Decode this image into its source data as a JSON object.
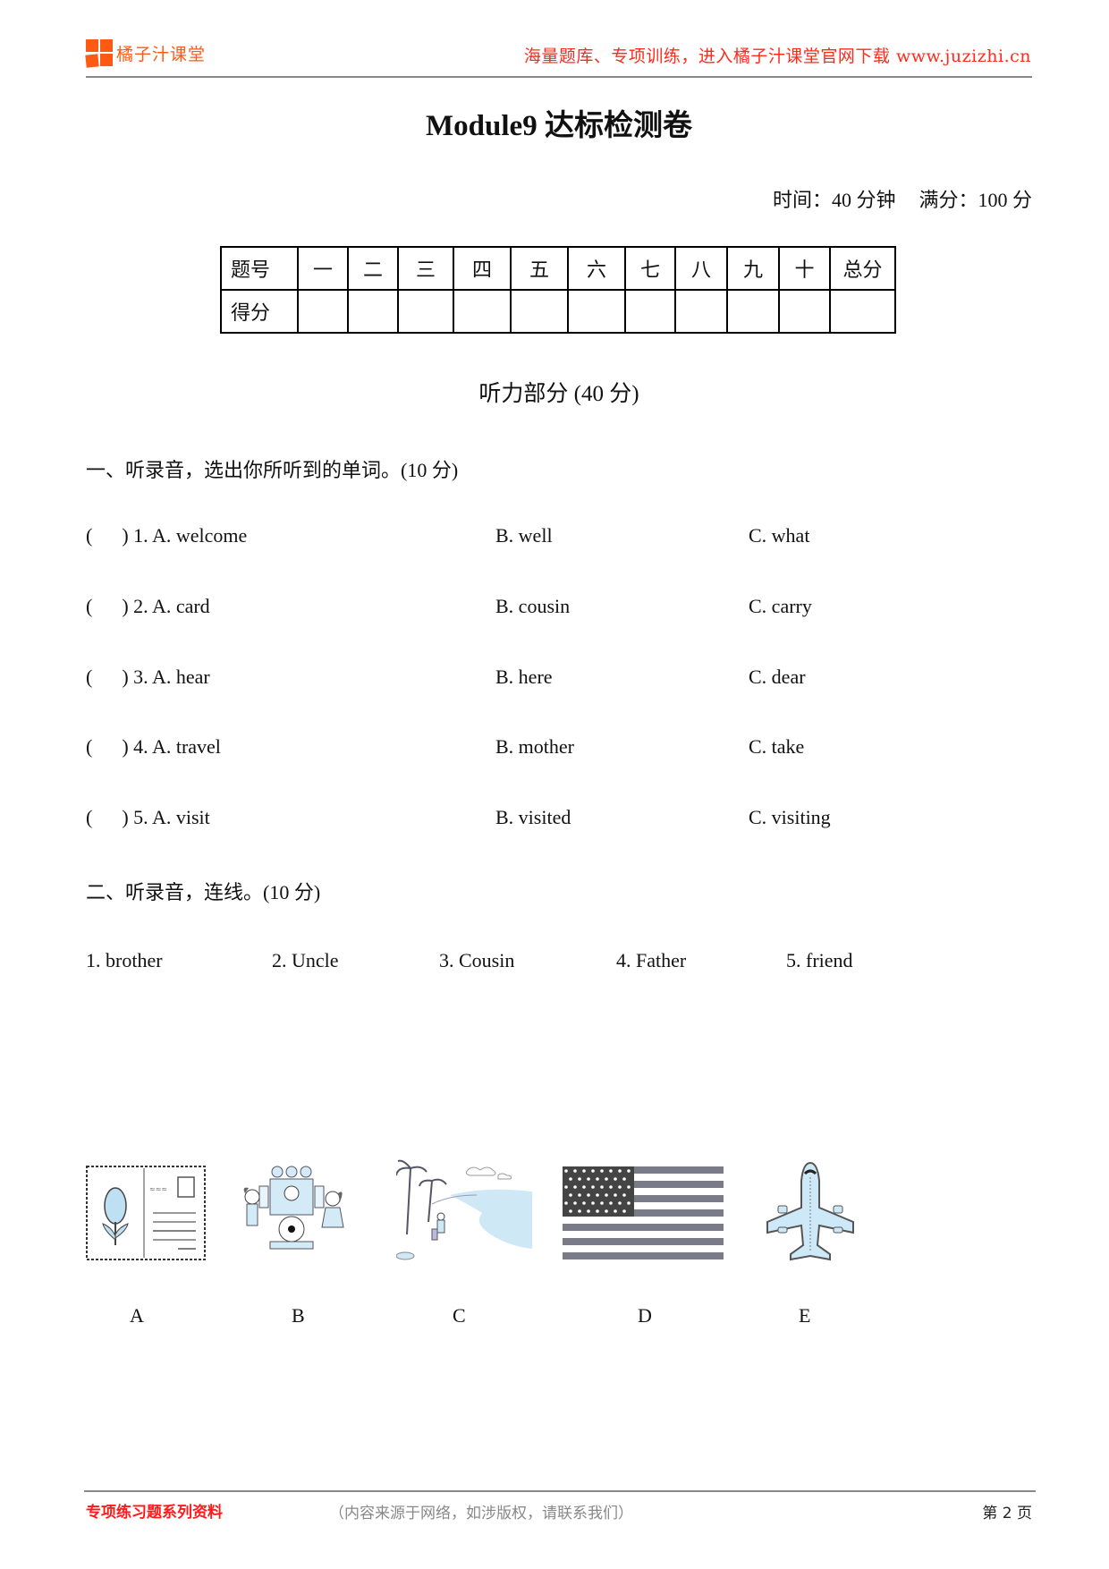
{
  "header": {
    "brand": "橘子汁课堂",
    "slogan": "海量题库、专项训练，进入橘子汁课堂官网下载 www.juzizhi.cn",
    "brand_color": "#ff5a14",
    "slogan_color": "#ff2a1a"
  },
  "title": "Module9 达标检测卷",
  "meta": {
    "time": "时间：40 分钟",
    "score": "满分：100 分"
  },
  "score_table": {
    "row1_label": "题号",
    "row2_label": "得分",
    "columns": [
      "一",
      "二",
      "三",
      "四",
      "五",
      "六",
      "七",
      "八",
      "九",
      "十",
      "总分"
    ]
  },
  "part_title": "听力部分 (40 分)",
  "section1": {
    "heading": "一、听录音，选出你所听到的单词。(10 分)",
    "questions": [
      {
        "a": "(      ) 1. A. welcome",
        "b": "B. well",
        "c": "C. what"
      },
      {
        "a": "(      ) 2. A. card",
        "b": "B. cousin",
        "c": "C. carry"
      },
      {
        "a": "(      ) 3. A. hear",
        "b": "B. here",
        "c": "C. dear"
      },
      {
        "a": "(      ) 4. A. travel",
        "b": "B. mother",
        "c": "C. take"
      },
      {
        "a": "(      ) 5. A. visit",
        "b": "B. visited",
        "c": "C. visiting"
      }
    ]
  },
  "section2": {
    "heading": "二、听录音，连线。(10 分)",
    "words": [
      "1. brother",
      "2. Uncle",
      "3. Cousin",
      "4. Father",
      "5. friend"
    ],
    "pictures": [
      {
        "label": "A",
        "icon": "postcard-icon"
      },
      {
        "label": "B",
        "icon": "band-performance-icon"
      },
      {
        "label": "C",
        "icon": "beach-travel-icon"
      },
      {
        "label": "D",
        "icon": "us-flag-icon"
      },
      {
        "label": "E",
        "icon": "airplane-icon"
      }
    ]
  },
  "footer": {
    "left": "专项练习题系列资料",
    "middle": "（内容来源于网络，如涉版权，请联系我们）",
    "page": "第 2 页",
    "left_color": "#ff1a1a"
  }
}
